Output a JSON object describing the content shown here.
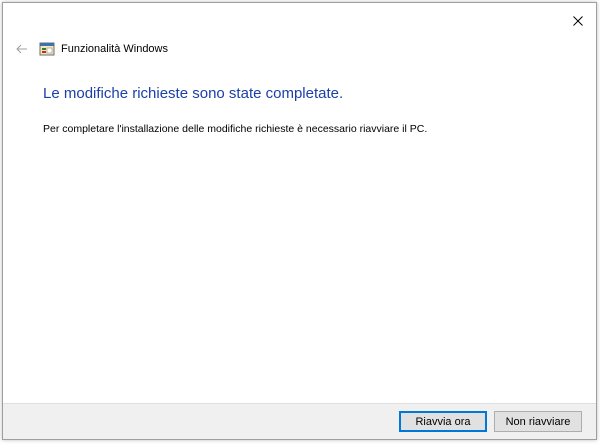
{
  "window": {
    "title": "Funzionalità Windows",
    "icons": {
      "back": "back-arrow-icon",
      "app": "windows-features-icon",
      "close": "close-icon"
    }
  },
  "content": {
    "heading": "Le modifiche richieste sono state completate.",
    "message": "Per completare l'installazione delle modifiche richieste è necessario riavviare il PC."
  },
  "buttons": {
    "restart_now": "Riavvia ora",
    "dont_restart": "Non riavviare"
  },
  "colors": {
    "heading": "#1c3fa8",
    "primary_border": "#0078d7",
    "footer_bg": "#f0f0f0"
  }
}
